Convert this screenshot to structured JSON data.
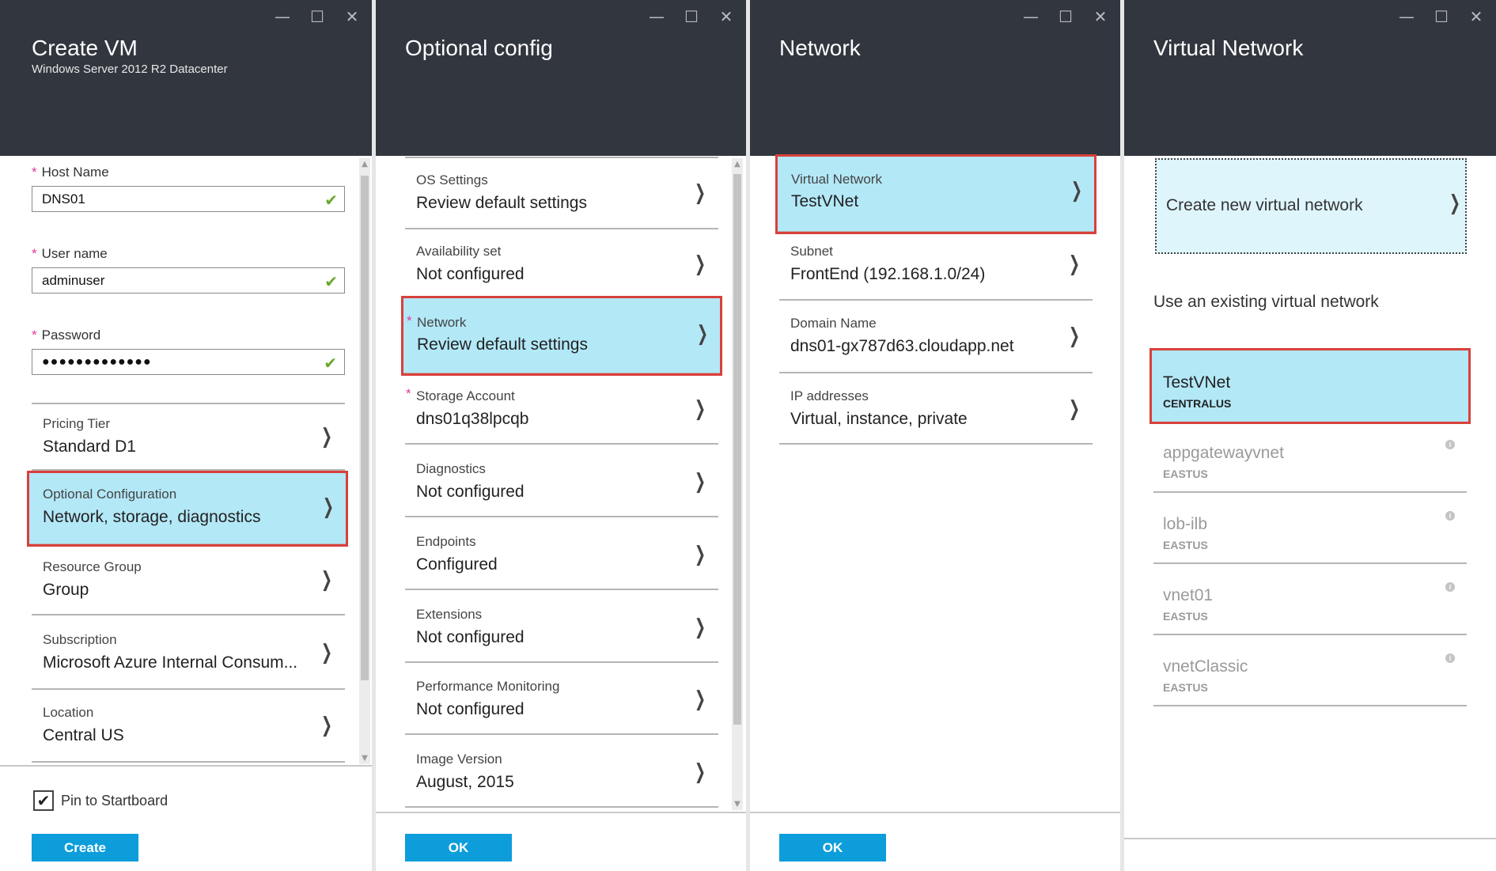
{
  "window_controls": {
    "minimize": "—",
    "maximize": "☐",
    "close": "✕"
  },
  "create_vm": {
    "title": "Create VM",
    "subtitle": "Windows Server 2012 R2 Datacenter",
    "required_marker": "*",
    "fields": [
      {
        "label": "Host Name",
        "value": "DNS01",
        "valid": true
      },
      {
        "label": "User name",
        "value": "adminuser",
        "valid": true
      },
      {
        "label": "Password",
        "value": "●●●●●●●●●●●●●",
        "valid": true
      }
    ],
    "rows": [
      {
        "label": "Pricing Tier",
        "value": "Standard D1",
        "selected": false
      },
      {
        "label": "Optional Configuration",
        "value": "Network, storage, diagnostics",
        "selected": true
      },
      {
        "label": "Resource Group",
        "value": "Group",
        "selected": false
      },
      {
        "label": "Subscription",
        "value": "Microsoft Azure Internal Consum...",
        "selected": false
      },
      {
        "label": "Location",
        "value": "Central US",
        "selected": false
      }
    ],
    "pin_label": "Pin to Startboard",
    "pin_checked": true,
    "create_label": "Create"
  },
  "optional_config": {
    "title": "Optional config",
    "rows": [
      {
        "label": "OS Settings",
        "value": "Review default settings",
        "required": false,
        "selected": false
      },
      {
        "label": "Availability set",
        "value": "Not configured",
        "required": false,
        "selected": false
      },
      {
        "label": "Network",
        "value": "Review default settings",
        "required": true,
        "selected": true
      },
      {
        "label": "Storage Account",
        "value": "dns01q38lpcqb",
        "required": true,
        "selected": false
      },
      {
        "label": "Diagnostics",
        "value": "Not configured",
        "required": false,
        "selected": false
      },
      {
        "label": "Endpoints",
        "value": "Configured",
        "required": false,
        "selected": false
      },
      {
        "label": "Extensions",
        "value": "Not configured",
        "required": false,
        "selected": false
      },
      {
        "label": "Performance Monitoring",
        "value": "Not configured",
        "required": false,
        "selected": false
      },
      {
        "label": "Image Version",
        "value": "August, 2015",
        "required": false,
        "selected": false
      }
    ],
    "ok_label": "OK"
  },
  "network": {
    "title": "Network",
    "rows": [
      {
        "label": "Virtual Network",
        "value": "TestVNet",
        "selected": true
      },
      {
        "label": "Subnet",
        "value": "FrontEnd (192.168.1.0/24)",
        "selected": false
      },
      {
        "label": "Domain Name",
        "value": "dns01-gx787d63.cloudapp.net",
        "selected": false
      },
      {
        "label": "IP addresses",
        "value": "Virtual, instance, private",
        "selected": false
      }
    ],
    "ok_label": "OK"
  },
  "virtual_network": {
    "title": "Virtual Network",
    "create_new_label": "Create new virtual network",
    "existing_heading": "Use an existing virtual network",
    "networks": [
      {
        "name": "TestVNet",
        "region": "CENTRALUS",
        "selected": true
      },
      {
        "name": "appgatewayvnet",
        "region": "EASTUS",
        "selected": false
      },
      {
        "name": "lob-ilb",
        "region": "EASTUS",
        "selected": false
      },
      {
        "name": "vnet01",
        "region": "EASTUS",
        "selected": false
      },
      {
        "name": "vnetClassic",
        "region": "EASTUS",
        "selected": false
      }
    ],
    "info_glyph": "i"
  },
  "chevron": "❯",
  "check_glyph": "✔",
  "colors": {
    "header_bg": "#32363f",
    "selected_bg": "#b3e8f7",
    "selected_border": "#d9403b",
    "button_bg": "#0d9ddb",
    "required": "#e03a98",
    "valid": "#6aa82e"
  }
}
